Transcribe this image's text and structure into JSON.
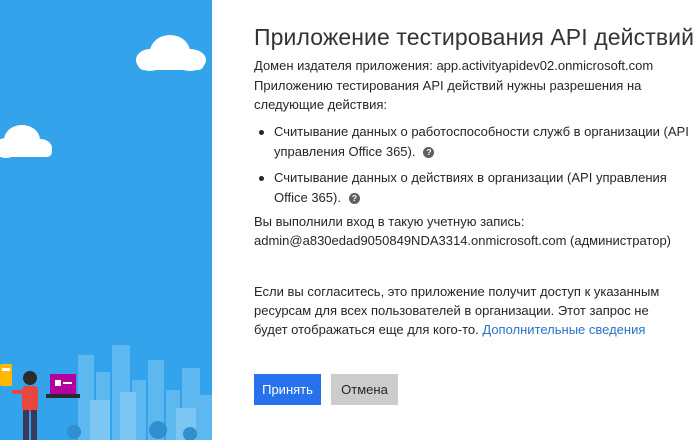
{
  "consent": {
    "title": "Приложение тестирования API действий",
    "domain_label": "Домен издателя приложения: ",
    "domain_value": "app.activityapidev02.onmicrosoft.com",
    "intro": "Приложению тестирования API действий нужны разрешения на следующие действия:",
    "permissions": [
      "Считывание данных о работоспособности служб в организации (API управления Office 365).",
      "Считывание данных о действиях в организации (API управления Office 365)."
    ],
    "help_glyph": "?",
    "signin_label": "Вы выполнили вход в такую учетную запись:",
    "signin_account": "admin@a830edad9050849NDA3314.onmicrosoft.com (администратор)",
    "consent_text": "Если вы согласитесь, это приложение получит доступ к указанным ресурсам для всех пользователей в организации. Этот запрос не будет отображаться еще для кого-то. ",
    "more_info_link": "Дополнительные сведения",
    "accept_label": "Принять",
    "cancel_label": "Отмена"
  },
  "colors": {
    "sky": "#33a3ec",
    "accent": "#2672ec",
    "link": "#2a73c6",
    "cancel_bg": "#cccccc"
  },
  "icons": {
    "help": "help-circle-icon",
    "bullet": "bullet-dot"
  }
}
